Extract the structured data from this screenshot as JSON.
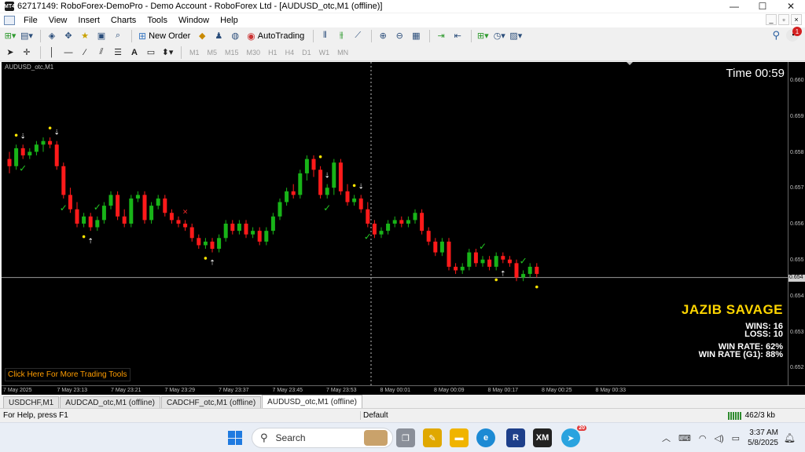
{
  "window": {
    "title": "62717149: RoboForex-DemoPro - Demo Account - RoboForex Ltd - [AUDUSD_otc,M1 (offline)]",
    "app_icon": "MT4",
    "controls": [
      "—",
      "☐",
      "✕"
    ]
  },
  "menu": {
    "items": [
      "File",
      "View",
      "Insert",
      "Charts",
      "Tools",
      "Window",
      "Help"
    ],
    "mdi_controls": [
      "_",
      "▫",
      "×"
    ]
  },
  "toolbar1": {
    "new_order": "New Order",
    "autotrading": "AutoTrading",
    "notification_count": "1"
  },
  "toolbar2": {
    "text_tool": "A",
    "timeframes": [
      "M1",
      "M5",
      "M15",
      "M30",
      "H1",
      "H4",
      "D1",
      "W1",
      "MN"
    ]
  },
  "chart": {
    "symbol_label": "AUDUSD_otc,M1",
    "timer": "Time 00:59",
    "tools_link": "Click Here For More Trading Tools",
    "price_labels": [
      "0.660",
      "0.659",
      "0.658",
      "0.657",
      "0.656",
      "0.655",
      "0.654",
      "0.653",
      "0.652"
    ],
    "current_price": "0.654",
    "time_labels": [
      "7 May 2025",
      "7 May 23:13",
      "7 May 23:21",
      "7 May 23:29",
      "7 May 23:37",
      "7 May 23:45",
      "7 May 23:53",
      "8 May 00:01",
      "8 May 00:09",
      "8 May 00:17",
      "8 May 00:25",
      "8 May 00:33"
    ],
    "colors": {
      "bull": "#18b418",
      "bear": "#ff1a1a",
      "background": "#000000",
      "signal_dot": "#ffe600",
      "check": "#22c422"
    }
  },
  "stats": {
    "title": "JAZIB SAVAGE",
    "wins": "WINS: 16",
    "loss": "LOSS: 10",
    "win_rate": "WIN RATE: 62%",
    "win_rate_g1": "WIN RATE (G1): 88%"
  },
  "tabs": [
    "USDCHF,M1",
    "AUDCAD_otc,M1 (offline)",
    "CADCHF_otc,M1 (offline)",
    "AUDUSD_otc,M1 (offline)"
  ],
  "active_tab": "AUDUSD_otc,M1 (offline)",
  "status": {
    "help": "For Help, press F1",
    "profile": "Default",
    "traffic": "462/3 kb"
  },
  "taskbar": {
    "search_placeholder": "Search",
    "time": "3:37 AM",
    "date": "5/8/2025",
    "telegram_badge": "20"
  },
  "candles": [
    [
      0.6578,
      0.658,
      0.6574,
      0.6576
    ],
    [
      0.6576,
      0.6582,
      0.6575,
      0.6581
    ],
    [
      0.6581,
      0.6582,
      0.6578,
      0.6579
    ],
    [
      0.6579,
      0.6581,
      0.6578,
      0.658
    ],
    [
      0.658,
      0.6583,
      0.6579,
      0.6582
    ],
    [
      0.6582,
      0.6584,
      0.658,
      0.6583
    ],
    [
      0.6583,
      0.6584,
      0.6581,
      0.6582
    ],
    [
      0.6582,
      0.6583,
      0.6575,
      0.6576
    ],
    [
      0.6576,
      0.6577,
      0.6567,
      0.6568
    ],
    [
      0.6568,
      0.657,
      0.6563,
      0.6564
    ],
    [
      0.6564,
      0.6566,
      0.6559,
      0.656
    ],
    [
      0.656,
      0.6563,
      0.6559,
      0.6562
    ],
    [
      0.6562,
      0.6563,
      0.6558,
      0.6559
    ],
    [
      0.6559,
      0.6562,
      0.6558,
      0.6561
    ],
    [
      0.6561,
      0.6566,
      0.656,
      0.6565
    ],
    [
      0.6565,
      0.6569,
      0.6564,
      0.6568
    ],
    [
      0.6568,
      0.6569,
      0.6561,
      0.6562
    ],
    [
      0.6562,
      0.6564,
      0.6559,
      0.656
    ],
    [
      0.656,
      0.6568,
      0.6559,
      0.6567
    ],
    [
      0.6567,
      0.6569,
      0.6566,
      0.6568
    ],
    [
      0.6568,
      0.6569,
      0.656,
      0.6561
    ],
    [
      0.6561,
      0.6566,
      0.656,
      0.6565
    ],
    [
      0.6565,
      0.6568,
      0.6564,
      0.6567
    ],
    [
      0.6567,
      0.6568,
      0.6562,
      0.6563
    ],
    [
      0.6563,
      0.6564,
      0.656,
      0.6561
    ],
    [
      0.6561,
      0.6562,
      0.6559,
      0.656
    ],
    [
      0.656,
      0.6561,
      0.6558,
      0.6559
    ],
    [
      0.6559,
      0.656,
      0.6555,
      0.6556
    ],
    [
      0.6556,
      0.6557,
      0.6553,
      0.6554
    ],
    [
      0.6554,
      0.6556,
      0.6553,
      0.6555
    ],
    [
      0.6555,
      0.6556,
      0.6552,
      0.6553
    ],
    [
      0.6553,
      0.6557,
      0.6552,
      0.6556
    ],
    [
      0.6556,
      0.6561,
      0.6555,
      0.656
    ],
    [
      0.656,
      0.6561,
      0.6557,
      0.6558
    ],
    [
      0.6558,
      0.6561,
      0.6557,
      0.656
    ],
    [
      0.656,
      0.6561,
      0.6556,
      0.6557
    ],
    [
      0.6557,
      0.6559,
      0.6556,
      0.6558
    ],
    [
      0.6558,
      0.6559,
      0.6554,
      0.6555
    ],
    [
      0.6555,
      0.6559,
      0.6554,
      0.6558
    ],
    [
      0.6558,
      0.6563,
      0.6557,
      0.6562
    ],
    [
      0.6562,
      0.6567,
      0.6561,
      0.6566
    ],
    [
      0.6566,
      0.657,
      0.6565,
      0.6569
    ],
    [
      0.6569,
      0.6571,
      0.6567,
      0.6568
    ],
    [
      0.6568,
      0.6575,
      0.6567,
      0.6574
    ],
    [
      0.6574,
      0.6579,
      0.6572,
      0.6578
    ],
    [
      0.6578,
      0.6579,
      0.6573,
      0.6575
    ],
    [
      0.6575,
      0.6576,
      0.6567,
      0.6568
    ],
    [
      0.6568,
      0.6571,
      0.6567,
      0.657
    ],
    [
      0.657,
      0.6578,
      0.6568,
      0.6577
    ],
    [
      0.6577,
      0.6578,
      0.6568,
      0.6569
    ],
    [
      0.6569,
      0.6571,
      0.6565,
      0.6566
    ],
    [
      0.6566,
      0.6568,
      0.6565,
      0.6567
    ],
    [
      0.6567,
      0.6568,
      0.6563,
      0.6564
    ],
    [
      0.6564,
      0.6566,
      0.6559,
      0.656
    ],
    [
      0.656,
      0.6561,
      0.6556,
      0.6557
    ],
    [
      0.6557,
      0.6559,
      0.6556,
      0.6558
    ],
    [
      0.6558,
      0.6561,
      0.6557,
      0.656
    ],
    [
      0.656,
      0.6562,
      0.6559,
      0.6561
    ],
    [
      0.6561,
      0.6562,
      0.6559,
      0.656
    ],
    [
      0.656,
      0.6562,
      0.6559,
      0.6561
    ],
    [
      0.6561,
      0.6564,
      0.656,
      0.6563
    ],
    [
      0.6563,
      0.6564,
      0.6557,
      0.6558
    ],
    [
      0.6558,
      0.6559,
      0.6554,
      0.6555
    ],
    [
      0.6555,
      0.6556,
      0.6551,
      0.6552
    ],
    [
      0.6552,
      0.6556,
      0.6551,
      0.6555
    ],
    [
      0.6555,
      0.6556,
      0.6547,
      0.6548
    ],
    [
      0.6548,
      0.6549,
      0.6546,
      0.6547
    ],
    [
      0.6547,
      0.6549,
      0.6546,
      0.6548
    ],
    [
      0.6548,
      0.6553,
      0.6547,
      0.6552
    ],
    [
      0.6552,
      0.6553,
      0.6548,
      0.6549
    ],
    [
      0.6549,
      0.6551,
      0.6548,
      0.655
    ],
    [
      0.655,
      0.6551,
      0.6547,
      0.6548
    ],
    [
      0.6548,
      0.6552,
      0.6547,
      0.6551
    ],
    [
      0.6551,
      0.6552,
      0.6549,
      0.655
    ],
    [
      0.655,
      0.6551,
      0.6548,
      0.6549
    ],
    [
      0.6549,
      0.655,
      0.6544,
      0.6545
    ],
    [
      0.6545,
      0.6547,
      0.6544,
      0.6546
    ],
    [
      0.6546,
      0.6549,
      0.6545,
      0.6548
    ],
    [
      0.6548,
      0.6549,
      0.6545,
      0.6546
    ]
  ],
  "signals": [
    {
      "i": 1,
      "type": "dot",
      "pos": "above"
    },
    {
      "i": 2,
      "type": "arrow-down",
      "pos": "above"
    },
    {
      "i": 2,
      "type": "check",
      "pos": "below"
    },
    {
      "i": 6,
      "type": "dot",
      "pos": "above"
    },
    {
      "i": 7,
      "type": "arrow-down",
      "pos": "above"
    },
    {
      "i": 8,
      "type": "check",
      "pos": "below"
    },
    {
      "i": 11,
      "type": "dot",
      "pos": "below"
    },
    {
      "i": 12,
      "type": "arrow-up",
      "pos": "below"
    },
    {
      "i": 13,
      "type": "check",
      "pos": "above"
    },
    {
      "i": 26,
      "type": "cross",
      "pos": "above"
    },
    {
      "i": 29,
      "type": "dot",
      "pos": "below"
    },
    {
      "i": 30,
      "type": "arrow-up",
      "pos": "below"
    },
    {
      "i": 46,
      "type": "dot",
      "pos": "above"
    },
    {
      "i": 47,
      "type": "arrow-down",
      "pos": "above"
    },
    {
      "i": 47,
      "type": "check",
      "pos": "below"
    },
    {
      "i": 51,
      "type": "dot",
      "pos": "above"
    },
    {
      "i": 52,
      "type": "arrow-down",
      "pos": "above"
    },
    {
      "i": 53,
      "type": "check",
      "pos": "below"
    },
    {
      "i": 70,
      "type": "check",
      "pos": "above"
    },
    {
      "i": 72,
      "type": "dot",
      "pos": "below"
    },
    {
      "i": 73,
      "type": "arrow-up",
      "pos": "below"
    },
    {
      "i": 76,
      "type": "check",
      "pos": "above"
    },
    {
      "i": 78,
      "type": "dot",
      "pos": "below"
    },
    {
      "i": 79,
      "type": "arrow-up",
      "pos": "below"
    },
    {
      "i": 88,
      "type": "check",
      "pos": "above"
    },
    {
      "i": 90,
      "type": "dot",
      "pos": "below"
    },
    {
      "i": 91,
      "type": "arrow-up",
      "pos": "below"
    }
  ]
}
